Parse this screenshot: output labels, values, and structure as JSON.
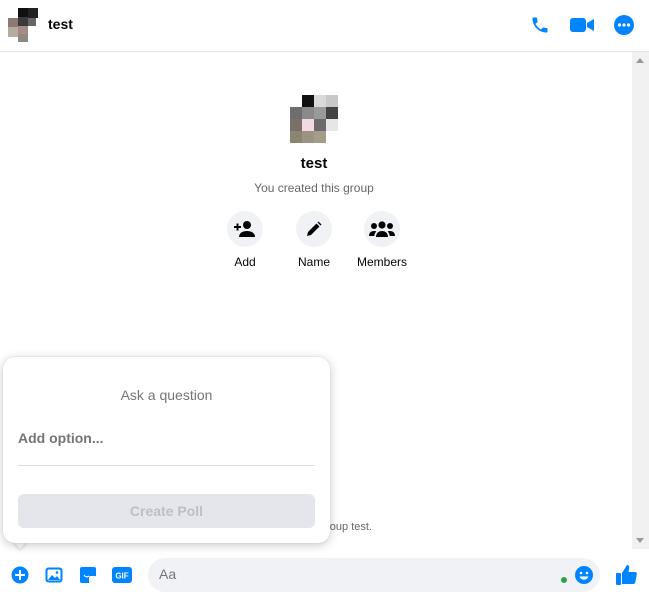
{
  "header": {
    "title": "test",
    "buttons": [
      "phone-icon",
      "video-camera-icon",
      "more-options-icon"
    ]
  },
  "group": {
    "name": "test",
    "subtitle": "You created this group",
    "actions": [
      {
        "label": "Add",
        "icon": "add-person-icon"
      },
      {
        "label": "Name",
        "icon": "pencil-icon"
      },
      {
        "label": "Members",
        "icon": "members-icon"
      }
    ],
    "partial_message": "group test."
  },
  "poll": {
    "question_placeholder": "Ask a question",
    "option_placeholder": "Add option...",
    "create_label": "Create Poll"
  },
  "composer": {
    "placeholder": "Aa",
    "icons": [
      "plus-icon",
      "photo-icon",
      "sticker-icon",
      "gif-icon",
      "emoji-icon",
      "thumbs-up-icon"
    ],
    "gif_label": "GIF"
  },
  "colors": {
    "accent": "#0084ff",
    "online": "#31a24c",
    "subtle_bg": "#f0f2f5"
  }
}
